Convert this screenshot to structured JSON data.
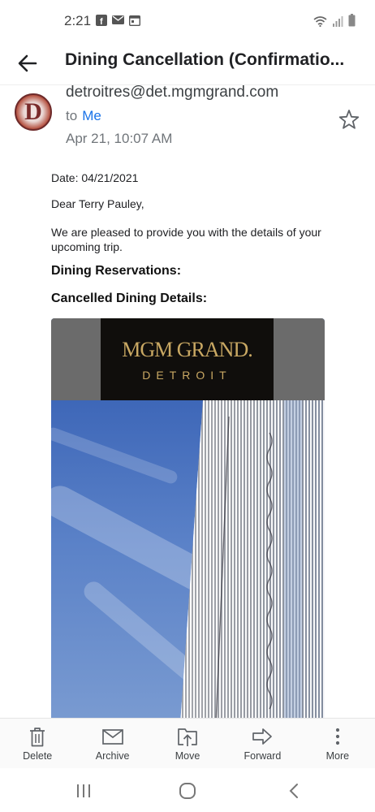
{
  "status_bar": {
    "time": "2:21",
    "left_icons": [
      "facebook-icon",
      "mail-icon",
      "calendar-icon"
    ],
    "right_icons": [
      "wifi-icon",
      "signal-icon",
      "battery-icon"
    ]
  },
  "toolbar": {
    "back_icon": "arrow-left-icon",
    "title": "Dining Cancellation (Confirmatio..."
  },
  "message": {
    "sender_initial": "D",
    "sender_email": "detroitres@det.mgmgrand.com",
    "to_prefix": "to",
    "to_recipient": "Me",
    "date": "Apr 21, 10:07 AM",
    "star_icon": "star-outline-icon"
  },
  "body": {
    "date_line": "Date: 04/21/2021",
    "greeting": "Dear Terry Pauley,",
    "paragraph": "We are pleased to provide you with the details of your upcoming trip.",
    "heading1": "Dining Reservations:",
    "heading2": "Cancelled Dining Details:"
  },
  "hero": {
    "logo_main": "MGM GRAND.",
    "logo_sub": "DETROIT"
  },
  "actions": [
    {
      "label": "Delete",
      "icon": "trash-icon"
    },
    {
      "label": "Archive",
      "icon": "archive-icon"
    },
    {
      "label": "Move",
      "icon": "move-icon"
    },
    {
      "label": "Forward",
      "icon": "forward-icon"
    },
    {
      "label": "More",
      "icon": "more-vertical-icon"
    }
  ],
  "navbar": {
    "icons": [
      "recent-apps-icon",
      "home-icon",
      "back-icon"
    ]
  },
  "colors": {
    "accent": "#1a73e8",
    "logo_gold": "#c9a863"
  }
}
